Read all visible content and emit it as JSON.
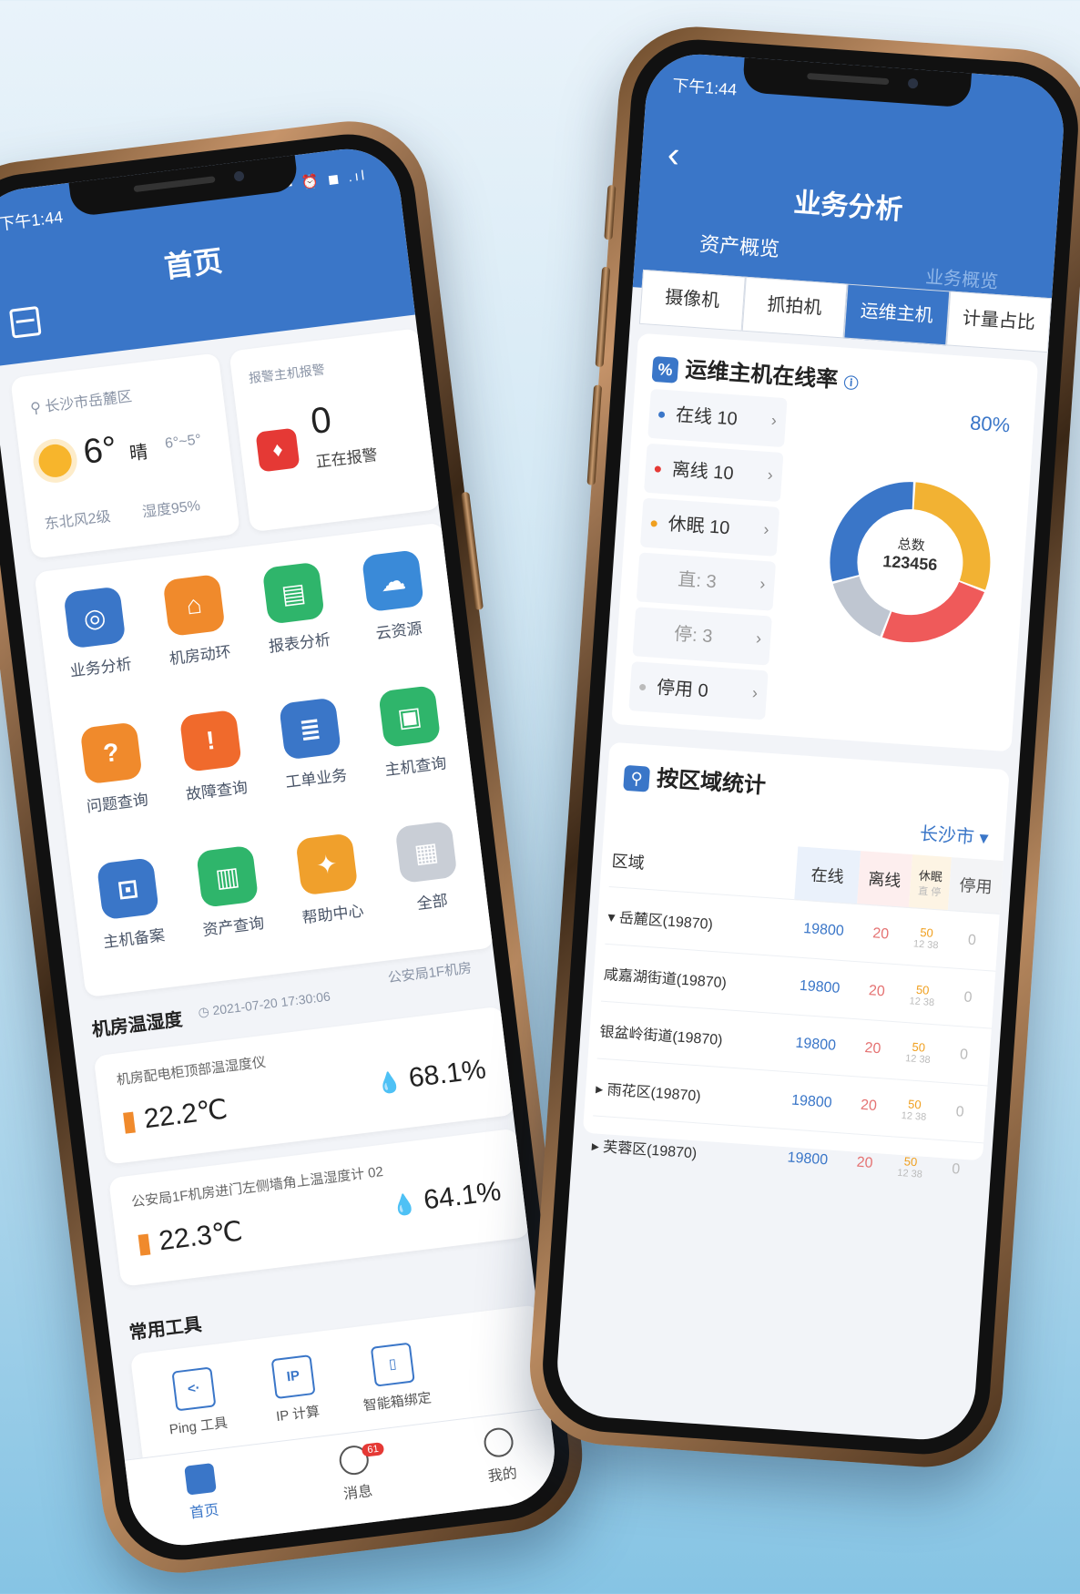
{
  "left_phone": {
    "status_time": "下午1:44",
    "status_icons": "▪ ⏰ ◼ .ıl",
    "title": "首页",
    "weather": {
      "location": "长沙市岳麓区",
      "temperature": "6°",
      "condition": "晴",
      "range": "6°~5°",
      "wind": "东北风2级",
      "humidity": "湿度95%"
    },
    "alarm": {
      "label": "报警主机报警",
      "count": "0",
      "status": "正在报警"
    },
    "grid": [
      {
        "label": "业务分析",
        "color": "#3a76c8",
        "icon": "◎"
      },
      {
        "label": "机房动环",
        "color": "#f08a2c",
        "icon": "⌂"
      },
      {
        "label": "报表分析",
        "color": "#2fb56b",
        "icon": "▤"
      },
      {
        "label": "云资源",
        "color": "#3a8ad8",
        "icon": "☁"
      },
      {
        "label": "问题查询",
        "color": "#f08a2c",
        "icon": "?"
      },
      {
        "label": "故障查询",
        "color": "#f06a2c",
        "icon": "!"
      },
      {
        "label": "工单业务",
        "color": "#3a76c8",
        "icon": "≣"
      },
      {
        "label": "主机查询",
        "color": "#2fb56b",
        "icon": "▣"
      },
      {
        "label": "主机备案",
        "color": "#3a76c8",
        "icon": "⊡"
      },
      {
        "label": "资产查询",
        "color": "#2fb56b",
        "icon": "▥"
      },
      {
        "label": "帮助中心",
        "color": "#f0a02c",
        "icon": "✦"
      },
      {
        "label": "全部",
        "color": "#c9ced6",
        "icon": "▦"
      }
    ],
    "room": {
      "title": "机房温湿度",
      "time": "2021-07-20 17:30:06",
      "location": "公安局1F机房",
      "sensors": [
        {
          "name": "机房配电柜顶部温湿度仪",
          "temp": "22.2℃",
          "humidity": "68.1%"
        },
        {
          "name": "公安局1F机房进门左侧墙角上温湿度计 02",
          "temp": "22.3℃",
          "humidity": "64.1%"
        }
      ]
    },
    "tools": {
      "title": "常用工具",
      "items": [
        {
          "label": "Ping 工具",
          "icon": "<·"
        },
        {
          "label": "IP 计算",
          "icon": "IP"
        },
        {
          "label": "智能箱绑定",
          "icon": "▯"
        }
      ]
    },
    "tabbar": {
      "home": "首页",
      "messages": "消息",
      "badge": "61",
      "mine": "我的"
    }
  },
  "right_phone": {
    "status_time": "下午1:44",
    "title": "业务分析",
    "sub_left": "资产概览",
    "sub_right": "业务概览",
    "tabs": [
      "摄像机",
      "抓拍机",
      "运维主机",
      "计量占比"
    ],
    "active_tab": 2,
    "online": {
      "title": "运维主机在线率",
      "percent": "80%",
      "rows": [
        {
          "label": "在线 10",
          "color": "#3a76c8"
        },
        {
          "label": "离线 10",
          "color": "#e53935"
        },
        {
          "label": "休眠 10",
          "color": "#f0a020"
        },
        {
          "label": "直: 3",
          "color": ""
        },
        {
          "label": "停: 3",
          "color": ""
        },
        {
          "label": "停用 0",
          "color": "#bbbbbb"
        }
      ],
      "donut_center_label": "总数",
      "donut_center_value": "123456",
      "donut": [
        {
          "value": 30,
          "color": "#f2b233"
        },
        {
          "value": 25,
          "color": "#ef5a5a"
        },
        {
          "value": 15,
          "color": "#bfc6d1"
        },
        {
          "value": 30,
          "color": "#3a76c8"
        }
      ]
    },
    "region": {
      "title": "按区域统计",
      "city": "长沙市",
      "headers": {
        "area": "区域",
        "online": "在线",
        "offline": "离线",
        "sleep": "休眠",
        "sleep_sub": "直 停",
        "stop": "停用"
      },
      "rows": [
        {
          "name": "▾ 岳麓区(19870)",
          "online": "19800",
          "offline": "20",
          "sleep": "50",
          "sleep_sub": "12 38",
          "stop": "0"
        },
        {
          "name": "咸嘉湖街道(19870)",
          "online": "19800",
          "offline": "20",
          "sleep": "50",
          "sleep_sub": "12 38",
          "stop": "0"
        },
        {
          "name": "银盆岭街道(19870)",
          "online": "19800",
          "offline": "20",
          "sleep": "50",
          "sleep_sub": "12 38",
          "stop": "0"
        },
        {
          "name": "▸ 雨花区(19870)",
          "online": "19800",
          "offline": "20",
          "sleep": "50",
          "sleep_sub": "12 38",
          "stop": "0"
        },
        {
          "name": "▸ 芙蓉区(19870)",
          "online": "19800",
          "offline": "20",
          "sleep": "50",
          "sleep_sub": "12 38",
          "stop": "0"
        }
      ]
    }
  }
}
